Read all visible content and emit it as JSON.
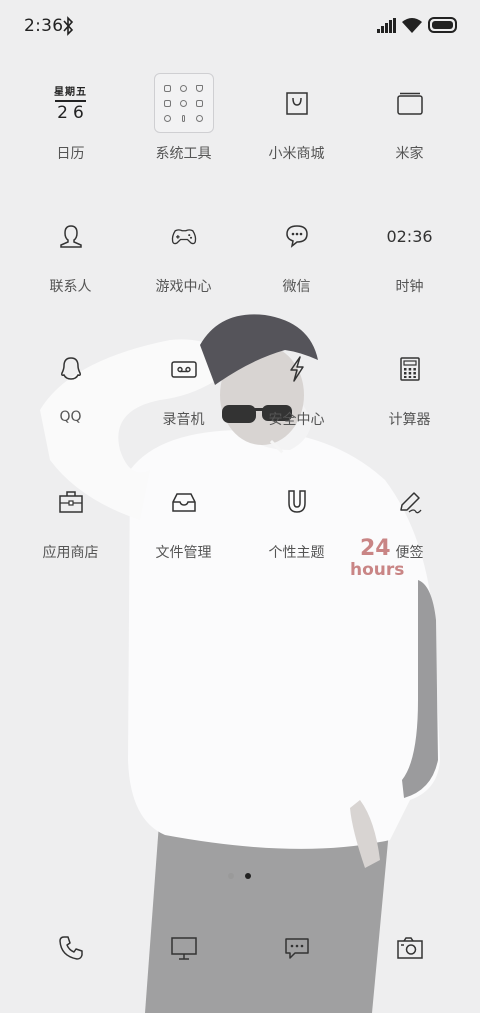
{
  "status_bar": {
    "time": "2:36",
    "icons": [
      "bluetooth-icon",
      "signal-icon",
      "wifi-icon",
      "battery-icon"
    ]
  },
  "calendar": {
    "weekday": "星期五",
    "day": "26"
  },
  "clock_widget_time": "02:36",
  "apps": [
    {
      "label": "日历",
      "icon": "calendar-icon"
    },
    {
      "label": "系统工具",
      "icon": "folder-icon"
    },
    {
      "label": "小米商城",
      "icon": "shopping-bag-icon"
    },
    {
      "label": "米家",
      "icon": "stacked-cards-icon"
    },
    {
      "label": "联系人",
      "icon": "contact-icon"
    },
    {
      "label": "游戏中心",
      "icon": "gamepad-icon"
    },
    {
      "label": "微信",
      "icon": "chat-bubble-icon"
    },
    {
      "label": "时钟",
      "icon": "clock-icon"
    },
    {
      "label": "QQ",
      "icon": "penguin-icon"
    },
    {
      "label": "录音机",
      "icon": "cassette-icon"
    },
    {
      "label": "安全中心",
      "icon": "lightning-icon"
    },
    {
      "label": "计算器",
      "icon": "calculator-icon"
    },
    {
      "label": "应用商店",
      "icon": "briefcase-icon"
    },
    {
      "label": "文件管理",
      "icon": "inbox-tray-icon"
    },
    {
      "label": "个性主题",
      "icon": "magnet-icon"
    },
    {
      "label": "便签",
      "icon": "pen-icon"
    }
  ],
  "page_indicator": {
    "count": 2,
    "active_index": 1
  },
  "dock": [
    {
      "icon": "phone-icon"
    },
    {
      "icon": "browser-monitor-icon"
    },
    {
      "icon": "messages-icon"
    },
    {
      "icon": "camera-icon"
    }
  ],
  "wallpaper": {
    "shirt_text_1": "24",
    "shirt_text_2": "hours",
    "accent_color": "#c98585"
  }
}
